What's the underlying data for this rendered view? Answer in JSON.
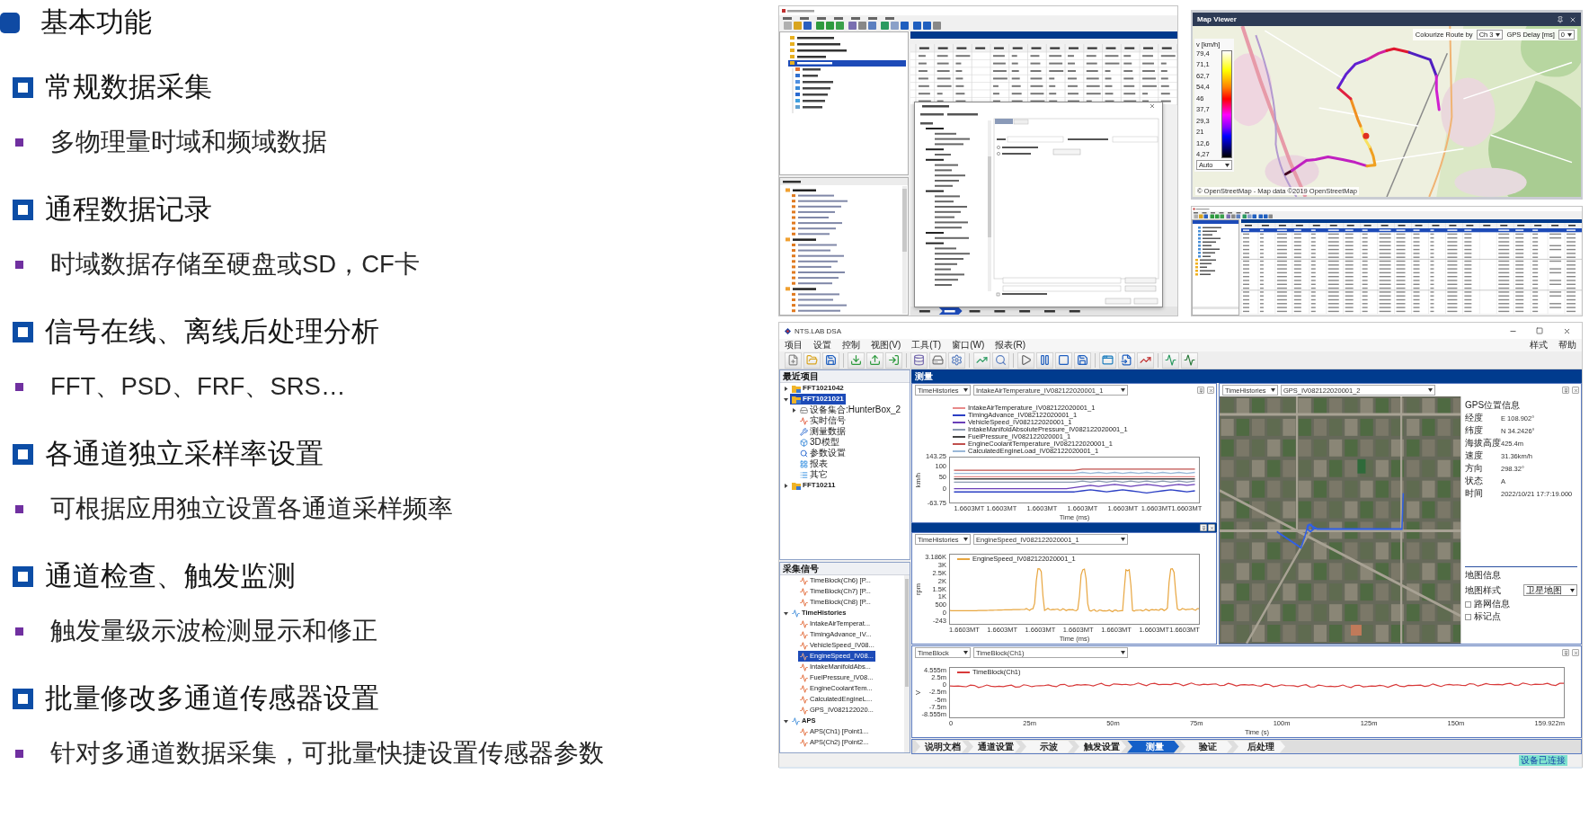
{
  "heading": {
    "text": "基本功能"
  },
  "features": [
    {
      "title": "常规数据采集",
      "detail": "多物理量时域和频域数据"
    },
    {
      "title": "通程数据记录",
      "detail": "时域数据存储至硬盘或SD，CF卡"
    },
    {
      "title": "信号在线、离线后处理分析",
      "detail": "FFT、PSD、FRF、SRS…"
    },
    {
      "title": "各通道独立采样率设置",
      "detail": "可根据应用独立设置各通道采样频率"
    },
    {
      "title": "通道检查、触发监测",
      "detail": "触发量级示波检测显示和修正"
    },
    {
      "title": "批量修改多通道传感器设置",
      "detail": "针对多通道数据采集，可批量快捷设置传感器参数"
    }
  ],
  "map_viewer": {
    "title": "Map Viewer",
    "legend_title": "v [km/h]",
    "legend_values": [
      "79,4",
      "71,1",
      "62,7",
      "54,4",
      "46",
      "37,7",
      "29,3",
      "21",
      "12,6",
      "4,27"
    ],
    "scale_mode": "Auto",
    "route_color_label": "Colourize Route by",
    "route_channel": "Ch 3",
    "gps_delay_label": "GPS Delay [ms]",
    "gps_delay": "0",
    "attribution": "© OpenStreetMap - Map data ©2019 OpenStreetMap"
  },
  "dsa_app": {
    "title": "NTS.LAB DSA",
    "menu": [
      "项目",
      "设置",
      "控制",
      "视图(V)",
      "工具(T)",
      "窗口(W)",
      "报表(R)"
    ],
    "menu_right": [
      "样式",
      "帮助"
    ],
    "projects": {
      "title": "最近项目",
      "items": [
        {
          "label": "FFT1021042",
          "expanded": false,
          "selected": false
        },
        {
          "label": "FFT1021021",
          "expanded": true,
          "selected": true,
          "children": [
            {
              "label": "设备集合:HunterBox_2",
              "expanded": false,
              "selected": false
            },
            {
              "label": "实时信号",
              "selected": false
            },
            {
              "label": "测量数据",
              "selected": false
            },
            {
              "label": "3D模型",
              "selected": false
            },
            {
              "label": "参数设置",
              "selected": false
            },
            {
              "label": "报表",
              "selected": false
            },
            {
              "label": "其它",
              "selected": false
            }
          ]
        },
        {
          "label": "FFT10211",
          "expanded": false,
          "selected": false
        }
      ]
    },
    "channels": {
      "title": "采集信号",
      "groups": [
        {
          "children": [
            {
              "label": "TimeBlock(Ch6) [P...",
              "selected": false
            },
            {
              "label": "TimeBlock(Ch7) [P...",
              "selected": false
            },
            {
              "label": "TimeBlock(Ch8) [P...",
              "selected": false
            }
          ]
        },
        {
          "label": "TimeHistories",
          "expanded": true,
          "selected": false,
          "children": [
            {
              "label": "IntakeAirTemperat...",
              "selected": false
            },
            {
              "label": "TimingAdvance_IV...",
              "selected": false
            },
            {
              "label": "VehicleSpeed_IV08...",
              "selected": false
            },
            {
              "label": "EngineSpeed_IV08...",
              "selected": true
            },
            {
              "label": "IntakeManifoldAbs...",
              "selected": false
            },
            {
              "label": "FuelPressure_IV08...",
              "selected": false
            },
            {
              "label": "EngineCoolantTem...",
              "selected": false
            },
            {
              "label": "CalculatedEngineL...",
              "selected": false
            },
            {
              "label": "GPS_IV082122020...",
              "selected": false
            }
          ]
        },
        {
          "label": "APS",
          "expanded": true,
          "selected": false,
          "children": [
            {
              "label": "APS(Ch1) [Point1...",
              "selected": false
            },
            {
              "label": "APS(Ch2) [Point2...",
              "selected": false
            }
          ]
        }
      ]
    },
    "workspace_title": "测量",
    "time_charts": [
      {
        "sources": [
          "TimeHistories",
          "IntakeAirTemperature_IV082122020001_1"
        ],
        "chart_data": {
          "type": "line",
          "xlabel": "Time (ms)",
          "ylabel": "km/h",
          "legend": "top",
          "categories": [
            null,
            null,
            "1.6603MT",
            null,
            null,
            null,
            "1.6603MT",
            null,
            null,
            null,
            null,
            "1.6603MT",
            null,
            null,
            null,
            null,
            "1.6603MT",
            null,
            null,
            null,
            null,
            "1.6603MT",
            null,
            null,
            null,
            null,
            null,
            "1.6603MT1.6603MT",
            null,
            null,
            null
          ],
          "ylim": [
            -63.75,
            143.25
          ],
          "yticks": [
            143.25,
            100,
            50,
            0,
            -63.75
          ],
          "series": [
            {
              "name": "IntakeAirTemperature_IV082122020001_1",
              "color": "#e88a8a",
              "values": [
                55,
                55,
                55,
                55,
                55,
                55,
                55,
                55,
                55,
                55,
                55,
                55,
                55,
                55,
                55,
                55,
                55,
                55,
                55,
                55,
                55,
                55,
                55,
                55,
                55,
                55,
                55,
                55,
                55,
                55,
                55
              ]
            },
            {
              "name": "TimingAdvance_IV082122020001_1",
              "color": "#2b3fc4",
              "values": [
                -15,
                -15,
                -15,
                -15,
                -15,
                -15,
                -15,
                -15,
                -15,
                -15,
                -15,
                -15,
                -15,
                -15,
                -15,
                -15,
                -10,
                -5,
                -10,
                -15,
                -10,
                -5,
                -10,
                -15,
                -20,
                -15,
                -10,
                -5,
                -10,
                -15,
                -10
              ]
            },
            {
              "name": "VehicleSpeed_IV082122020001_1",
              "color": "#6a3fb8",
              "values": [
                0,
                0,
                0,
                0,
                0,
                0,
                0,
                0,
                0,
                0,
                0,
                0,
                0,
                0,
                0,
                5,
                10,
                15,
                10,
                15,
                20,
                15,
                10,
                15,
                20,
                15,
                10,
                15,
                20,
                15,
                20
              ]
            },
            {
              "name": "IntakeManifoldAbsolutePressure_IV082122020001_1",
              "color": "#8a9ab0",
              "values": [
                30,
                30,
                30,
                30,
                30,
                30,
                30,
                30,
                30,
                30,
                30,
                30,
                30,
                30,
                30,
                30,
                35,
                30,
                35,
                30,
                35,
                30,
                35,
                30,
                35,
                30,
                35,
                30,
                35,
                30,
                35
              ]
            },
            {
              "name": "FuelPressure_IV082122020001_1",
              "color": "#444444",
              "values": [
                45,
                45,
                45,
                45,
                45,
                45,
                45,
                45,
                45,
                45,
                45,
                45,
                45,
                45,
                45,
                45,
                45,
                45,
                45,
                45,
                45,
                45,
                45,
                45,
                45,
                45,
                45,
                45,
                45,
                45,
                45
              ]
            },
            {
              "name": "EngineCoolantTemperature_IV082122020001_1",
              "color": "#c0504d",
              "values": [
                85,
                85,
                85,
                85,
                85,
                85,
                85,
                85,
                85,
                85,
                85,
                85,
                85,
                85,
                85,
                85,
                90,
                90,
                90,
                90,
                90,
                90,
                90,
                90,
                90,
                90,
                90,
                90,
                90,
                90,
                90
              ]
            },
            {
              "name": "CalculatedEngineLoad_IV082122020001_1",
              "color": "#9ab8d8",
              "values": [
                70,
                70,
                70,
                70,
                70,
                70,
                70,
                70,
                70,
                70,
                70,
                70,
                70,
                70,
                70,
                70,
                75,
                70,
                75,
                70,
                75,
                70,
                75,
                70,
                75,
                70,
                75,
                70,
                75,
                70,
                75
              ]
            }
          ]
        }
      },
      {
        "sources": [
          "TimeHistories",
          "EngineSpeed_IV082122020001_1"
        ],
        "ylabel": "rpm",
        "yticks": [
          "3.186K",
          "3K",
          "2.5K",
          "2K",
          "1.5K",
          "1K",
          "500",
          "0",
          "-243"
        ],
        "xticks": [
          "1.6603MT",
          "1.6603MT",
          "1.6603MT",
          "1.6603MT",
          "1.6603MT",
          "1.6603MT1.6603MT"
        ],
        "xlabel": "Time (ms)",
        "legend": [
          {
            "name": "EngineSpeed_IV082122020001_1",
            "color": "#e8a640"
          }
        ]
      }
    ],
    "gps_map": {
      "sources": [
        "TimeHistories",
        "GPS_IV082122020001_2"
      ],
      "info_title": "GPS位置信息",
      "info": [
        {
          "label": "经度",
          "value": "E 108.902°"
        },
        {
          "label": "纬度",
          "value": "N 34.2426°"
        },
        {
          "label": "海拔高度",
          "value": "425.4m"
        },
        {
          "label": "速度",
          "value": "31.36km/h"
        },
        {
          "label": "方向",
          "value": "298.32°"
        },
        {
          "label": "状态",
          "value": "A"
        },
        {
          "label": "时间",
          "value": "2022/10/21 17:7:19.000"
        }
      ],
      "map_info_title": "地图信息",
      "style_label": "地图样式",
      "style_value": "卫星地图",
      "options": [
        {
          "label": "路网信息",
          "checked": false
        },
        {
          "label": "标记点",
          "checked": false
        }
      ]
    },
    "block_chart": {
      "sources": [
        "TimeBlock",
        "TimeBlock(Ch1)"
      ],
      "ylabel": "V",
      "yticks": [
        "4.555m",
        "2.5m",
        "0",
        "-2.5m",
        "-5m",
        "-7.5m",
        "-8.555m"
      ],
      "xticks": [
        "0",
        "25m",
        "50m",
        "75m",
        "100m",
        "125m",
        "150m",
        "159.922m"
      ],
      "xlabel": "Time (s)",
      "legend": [
        {
          "name": "TimeBlock(Ch1)",
          "color": "#d83a3a"
        }
      ]
    },
    "steps": [
      {
        "label": "说明文档",
        "selected": false
      },
      {
        "label": "通道设置",
        "selected": false
      },
      {
        "label": "示波",
        "selected": false
      },
      {
        "label": "触发设置",
        "selected": false
      },
      {
        "label": "测量",
        "selected": true
      },
      {
        "label": "验证",
        "selected": false
      },
      {
        "label": "后处理",
        "selected": false
      }
    ],
    "status": "设备已连接"
  }
}
